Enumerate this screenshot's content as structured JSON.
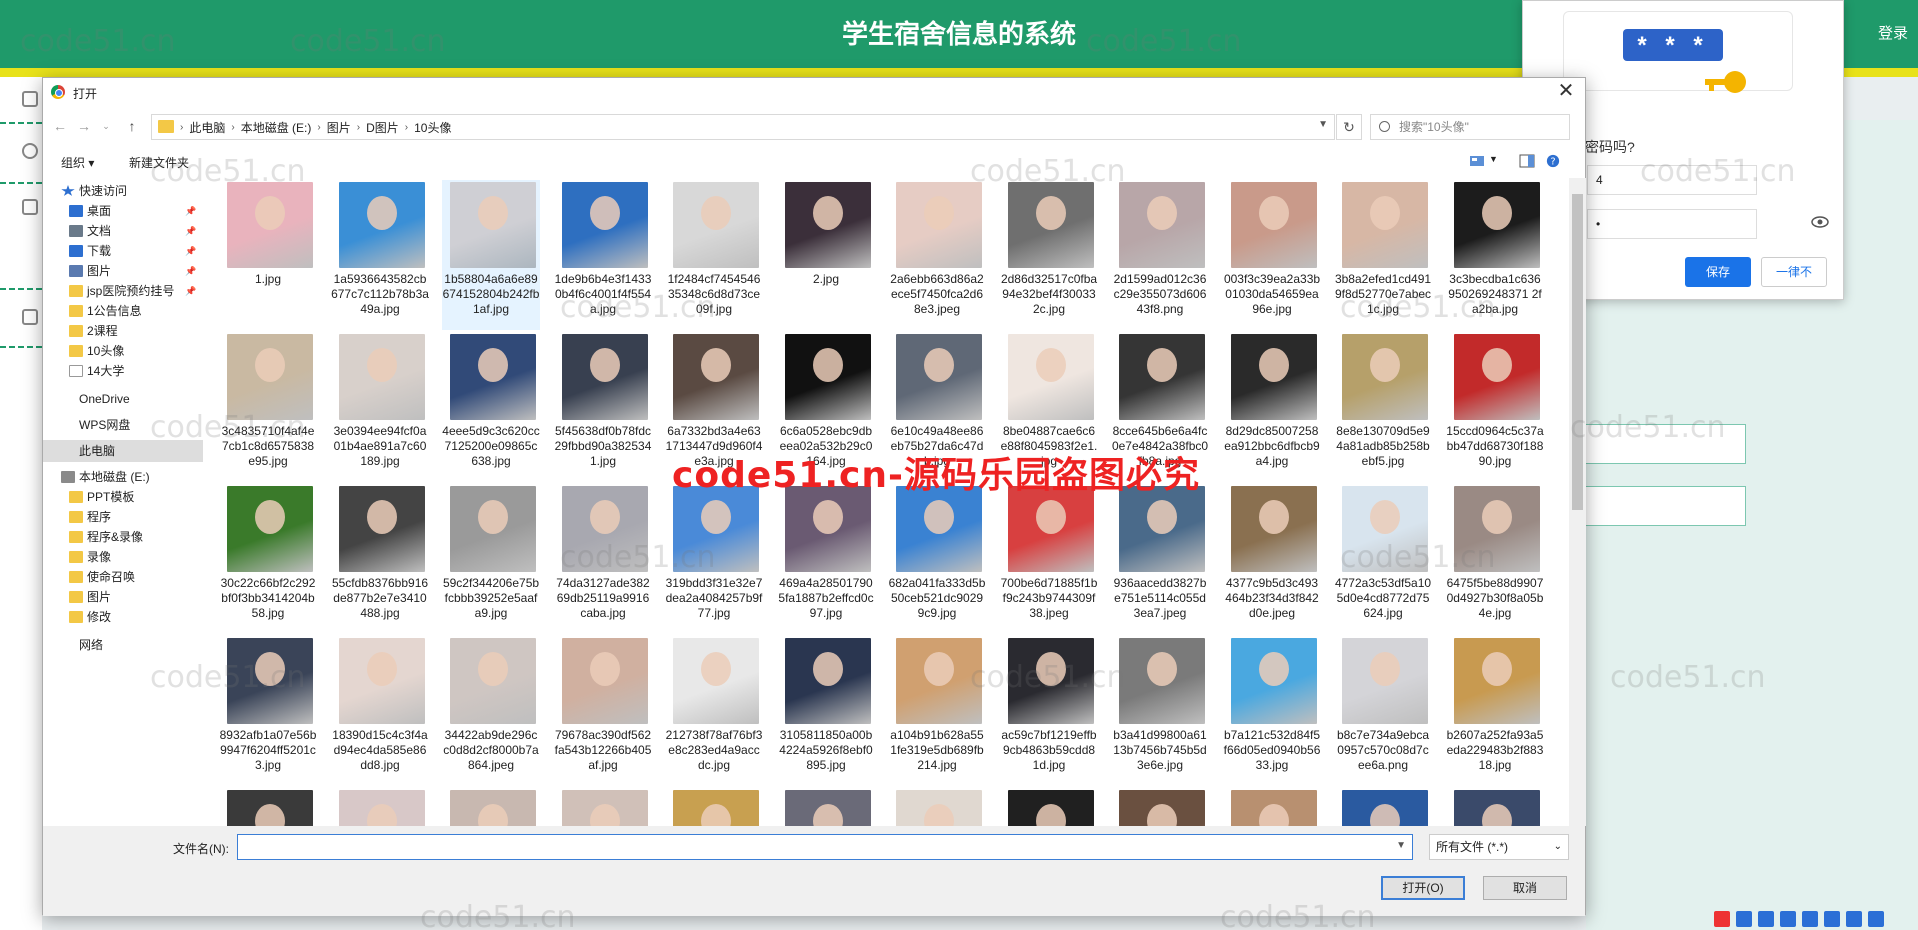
{
  "app": {
    "title": "学生宿舍信息的系统",
    "login": "登录"
  },
  "watermarks": {
    "main": "code51.cn-源码乐园盗图必究",
    "repeat": "code51.cn"
  },
  "password_popup": {
    "badge": "* * *",
    "question": "密码吗?",
    "username_value": "4",
    "password_value": "•",
    "save": "保存",
    "never": "一律不"
  },
  "dialog": {
    "title": "打开",
    "close": "✕",
    "address": [
      "此电脑",
      "本地磁盘 (E:)",
      "图片",
      "D图片",
      "10头像"
    ],
    "search_placeholder": "搜索\"10头像\"",
    "toolbar": {
      "organize": "组织 ▾",
      "new_folder": "新建文件夹"
    },
    "nav": [
      {
        "label": "快速访问",
        "type": "star"
      },
      {
        "label": "桌面",
        "type": "desktop",
        "pinned": true
      },
      {
        "label": "文档",
        "type": "doc",
        "pinned": true
      },
      {
        "label": "下载",
        "type": "download",
        "pinned": true
      },
      {
        "label": "图片",
        "type": "pic",
        "pinned": true
      },
      {
        "label": "jsp医院预约挂号",
        "type": "folder",
        "pinned": true
      },
      {
        "label": "1公告信息",
        "type": "folder"
      },
      {
        "label": "2课程",
        "type": "folder"
      },
      {
        "label": "10头像",
        "type": "folder"
      },
      {
        "label": "14大学",
        "type": "file"
      },
      {
        "label": "OneDrive",
        "type": "cloud"
      },
      {
        "label": "WPS网盘",
        "type": "cloud"
      },
      {
        "label": "此电脑",
        "type": "pc"
      },
      {
        "label": "本地磁盘 (E:)",
        "type": "drive"
      },
      {
        "label": "PPT模板",
        "type": "folder"
      },
      {
        "label": "程序",
        "type": "folder"
      },
      {
        "label": "程序&录像",
        "type": "folder"
      },
      {
        "label": "录像",
        "type": "folder"
      },
      {
        "label": "使命召唤",
        "type": "folder"
      },
      {
        "label": "图片",
        "type": "folder"
      },
      {
        "label": "修改",
        "type": "folder"
      },
      {
        "label": "网络",
        "type": "network"
      }
    ],
    "files": [
      {
        "name": "1.jpg",
        "color": "#e9b3bd"
      },
      {
        "name": "1a5936643582cb677c7c112b78b3a49a.jpg",
        "color": "#3a8fd6"
      },
      {
        "name": "1b58804a6a6e89674152804b242fb1af.jpg",
        "color": "#cfcfd4"
      },
      {
        "name": "1de9b6b4e3f14330b4f6c4001f4f554a.jpg",
        "color": "#2e6fc0"
      },
      {
        "name": "1f2484cf745454635348c6d8d73ce09f.jpg",
        "color": "#d8d8d8"
      },
      {
        "name": "2.jpg",
        "color": "#3b2f3a"
      },
      {
        "name": "2a6ebb663d86a2ece5f7450fca2d68e3.jpeg",
        "color": "#e6ccc4"
      },
      {
        "name": "2d86d32517c0fba94e32bef4f300332c.jpg",
        "color": "#6f6f6f"
      },
      {
        "name": "2d1599ad012c36c29e355073d60643f8.png",
        "color": "#b8a6a8"
      },
      {
        "name": "003f3c39ea2a33b01030da54659ea96e.jpg",
        "color": "#c99a8a"
      },
      {
        "name": "3b8a2efed1cd4919f8d52770e7abec1c.jpg",
        "color": "#d7b7a5"
      },
      {
        "name": "3c3becdba1c636950269248371 2fa2ba.jpg",
        "color": "#1c1c1c"
      },
      {
        "name": "3c4835710f4af4e7cb1c8d6575838e95.jpg",
        "color": "#c9b9a2"
      },
      {
        "name": "3e0394ee94fcf0a01b4ae891a7c60189.jpg",
        "color": "#d8d0cb"
      },
      {
        "name": "4eee5d9c3c620cc7125200e09865c638.jpg",
        "color": "#314a78"
      },
      {
        "name": "5f45638df0b78fdc29fbbd90a3825341.jpg",
        "color": "#384050"
      },
      {
        "name": "6a7332bd3a4e631713447d9d960f4e3a.jpg",
        "color": "#5a4a42"
      },
      {
        "name": "6c6a0528ebc9dbeea02a532b29c0164.jpg",
        "color": "#111111"
      },
      {
        "name": "6e10c49a48ee86eb75b27da6c47db.jpg",
        "color": "#5f6876"
      },
      {
        "name": "8be04887cae6c6e88f8045983f2e1.jpg",
        "color": "#efe6e0"
      },
      {
        "name": "8cce645b6e6a4fc0e7e4842a38fbc0fb8a.jpg",
        "color": "#353535"
      },
      {
        "name": "8d29dc85007258ea912bbc6dfbcb9a4.jpg",
        "color": "#2a2a2a"
      },
      {
        "name": "8e8e130709d5e94a81adb85b258bebf5.jpg",
        "color": "#b6a06a"
      },
      {
        "name": "15ccd0964c5c37abb47dd68730f18890.jpg",
        "color": "#c22a2a"
      },
      {
        "name": "30c22c66bf2c292bf0f3bb3414204b58.jpg",
        "color": "#3a7a2a"
      },
      {
        "name": "55cfdb8376bb916de877b2e7e3410488.jpg",
        "color": "#444444"
      },
      {
        "name": "59c2f344206e75bfcbbb39252e5aafa9.jpg",
        "color": "#9a9a9a"
      },
      {
        "name": "74da3127ade38269db25119a9916caba.jpg",
        "color": "#a8a8b0"
      },
      {
        "name": "319bdd3f31e32e7dea2a4084257b9f77.jpg",
        "color": "#4a8ad8"
      },
      {
        "name": "469a4a285017905fa1887b2effcd0c97.jpg",
        "color": "#6a5a72"
      },
      {
        "name": "682a041fa333d5b50ceb521dc90299c9.jpg",
        "color": "#3a82d2"
      },
      {
        "name": "700be6d71885f1bf9c243b9744309f38.jpeg",
        "color": "#d84040"
      },
      {
        "name": "936aacedd3827be751e5114c055d3ea7.jpeg",
        "color": "#4a6a8a"
      },
      {
        "name": "4377c9b5d3c493464b23f34d3f842d0e.jpeg",
        "color": "#8a7050"
      },
      {
        "name": "4772a3c53df5a105d0e4cd8772d75624.jpg",
        "color": "#d8e4ee"
      },
      {
        "name": "6475f5be88d99070d4927b30f8a05b4e.jpg",
        "color": "#9a8a84"
      },
      {
        "name": "8932afb1a07e56b9947f6204ff5201c3.jpg",
        "color": "#3a4458"
      },
      {
        "name": "18390d15c4c3f4ad94ec4da585e86dd8.jpg",
        "color": "#e4d6d0"
      },
      {
        "name": "34422ab9de296cc0d8d2cf8000b7a864.jpeg",
        "color": "#cfc6c2"
      },
      {
        "name": "79678ac390df562fa543b12266b405af.jpg",
        "color": "#d0b0a0"
      },
      {
        "name": "212738f78af76bf3e8c283ed4a9accdc.jpg",
        "color": "#e8e8e8"
      },
      {
        "name": "3105811850a00b4224a5926f8ebf0895.jpg",
        "color": "#2a3650"
      },
      {
        "name": "a104b91b628a551fe319e5db689fb214.jpg",
        "color": "#d0a070"
      },
      {
        "name": "ac59c7bf1219effb9cb4863b59cdd81d.jpg",
        "color": "#2a2a30"
      },
      {
        "name": "b3a41d99800a6113b7456b745b5d3e6e.jpg",
        "color": "#7a7a7a"
      },
      {
        "name": "b7a121c532d84f5f66d05ed0940b5633.jpg",
        "color": "#4aa8e0"
      },
      {
        "name": "b8c7e734a9ebca0957c570c08d7cee6a.png",
        "color": "#d4d4d8"
      },
      {
        "name": "b2607a252fa93a5eda229483b2f88318.jpg",
        "color": "#c89a50"
      },
      {
        "name": "",
        "color": "#3a3a3a"
      },
      {
        "name": "",
        "color": "#d8c8c8"
      },
      {
        "name": "",
        "color": "#c8b8b0"
      },
      {
        "name": "",
        "color": "#d0c0b8"
      },
      {
        "name": "",
        "color": "#c8a050"
      },
      {
        "name": "",
        "color": "#6a6a78"
      },
      {
        "name": "",
        "color": "#e0d8d0"
      },
      {
        "name": "",
        "color": "#202020"
      },
      {
        "name": "",
        "color": "#6a5040"
      },
      {
        "name": "",
        "color": "#b89070"
      },
      {
        "name": "",
        "color": "#2a5aa0"
      },
      {
        "name": "",
        "color": "#3a4a6a"
      }
    ],
    "filename_label": "文件名(N):",
    "filename_value": "",
    "filter": "所有文件 (*.*)",
    "open": "打开(O)",
    "cancel": "取消"
  }
}
